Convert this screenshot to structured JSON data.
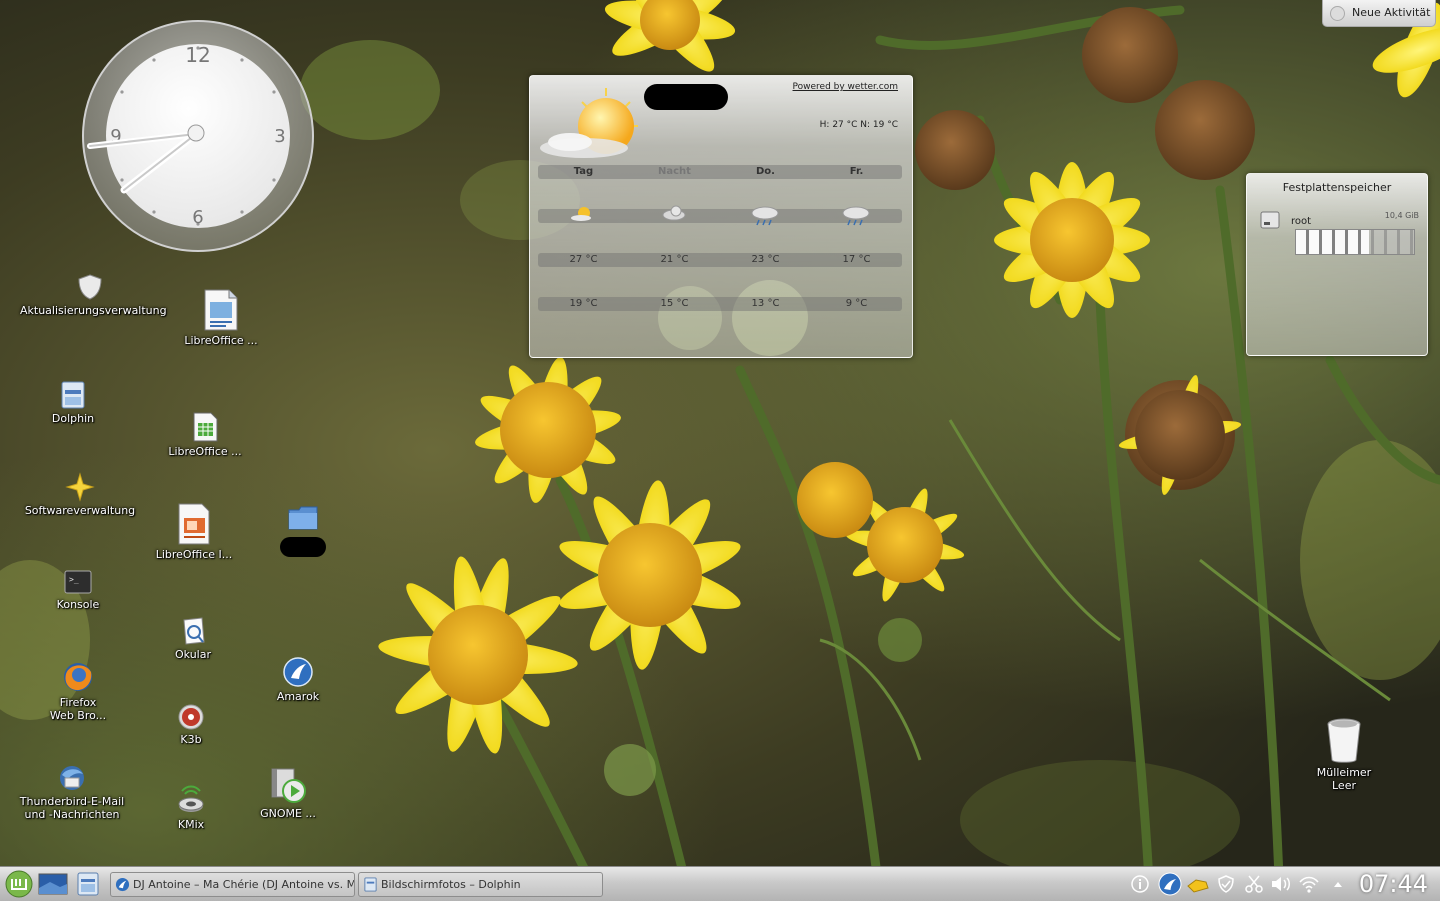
{
  "activity_button": {
    "label": "Neue Aktivität"
  },
  "clock": {
    "twelve": "12",
    "three": "3",
    "six": "6",
    "nine": "9"
  },
  "desktop_icons": {
    "aktualisierung": "Aktualisierungsverwaltung",
    "libreoffice_impress": "LibreOffice ...",
    "dolphin": "Dolphin",
    "libreoffice_calc": "LibreOffice ...",
    "software": "Softwareverwaltung",
    "libreoffice_impress2": "LibreOffice I...",
    "konsole": "Konsole",
    "okular": "Okular",
    "firefox": "Firefox\nWeb Bro...",
    "amarok": "Amarok",
    "k3b": "K3b",
    "thunderbird": "Thunderbird-E-Mail\nund -Nachrichten",
    "kmix": "KMix",
    "gnome": "GNOME ...",
    "trash": "Mülleimer\nLeer"
  },
  "weather": {
    "powered": "Powered by wetter.com",
    "hilo": "H: 27 °C N: 19 °C",
    "headers": [
      "Tag",
      "Nacht",
      "Do.",
      "Fr."
    ],
    "high": [
      "27 °C",
      "21 °C",
      "23 °C",
      "17 °C"
    ],
    "low": [
      "19 °C",
      "15 °C",
      "13 °C",
      "9 °C"
    ],
    "icons": [
      "sun-small-icon",
      "night-cloud-icon",
      "rain-cloud-icon",
      "rain-cloud-icon"
    ]
  },
  "disk": {
    "title": "Festplattenspeicher",
    "drive": "root",
    "size": "10,4 GiB",
    "used_fraction": 0.62
  },
  "taskbar": {
    "tasks": [
      "DJ Antoine – Ma Chérie (DJ Antoine vs. Mad",
      "Bildschirmfotos – Dolphin"
    ],
    "time": "07:44"
  }
}
